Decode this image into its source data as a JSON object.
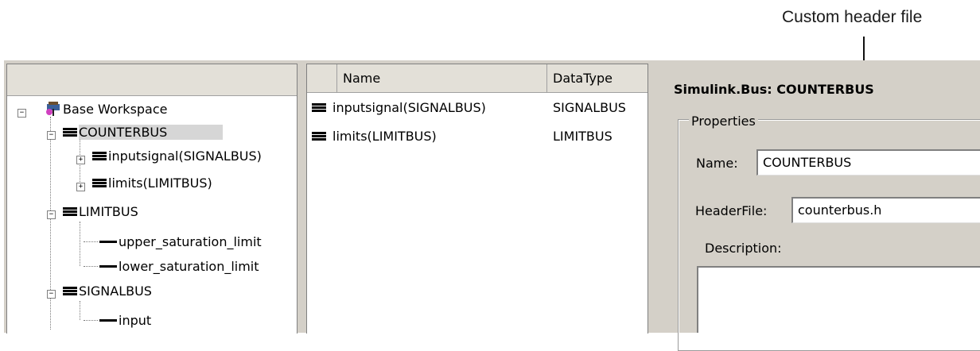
{
  "annotation": {
    "text": "Custom header file"
  },
  "tree": {
    "root_label": "Base Workspace",
    "items": [
      {
        "label": "COUNTERBUS",
        "selected": true
      },
      {
        "label": "inputsignal(SIGNALBUS)"
      },
      {
        "label": "limits(LIMITBUS)"
      },
      {
        "label": "LIMITBUS"
      },
      {
        "label": "upper_saturation_limit"
      },
      {
        "label": "lower_saturation_limit"
      },
      {
        "label": "SIGNALBUS"
      },
      {
        "label": "input"
      }
    ]
  },
  "list": {
    "columns": {
      "name": "Name",
      "datatype": "DataType"
    },
    "rows": [
      {
        "name": "inputsignal(SIGNALBUS)",
        "datatype": "SIGNALBUS"
      },
      {
        "name": "limits(LIMITBUS)",
        "datatype": "LIMITBUS"
      }
    ]
  },
  "properties": {
    "title": "Simulink.Bus: COUNTERBUS",
    "group_label": "Properties",
    "name_label": "Name:",
    "name_value": "COUNTERBUS",
    "headerfile_label": "HeaderFile:",
    "headerfile_value": "counterbus.h",
    "description_label": "Description:"
  },
  "colors": {
    "panel": "#d4d0c8",
    "header": "#e3e0d8",
    "selected": "#d6d6d6"
  }
}
